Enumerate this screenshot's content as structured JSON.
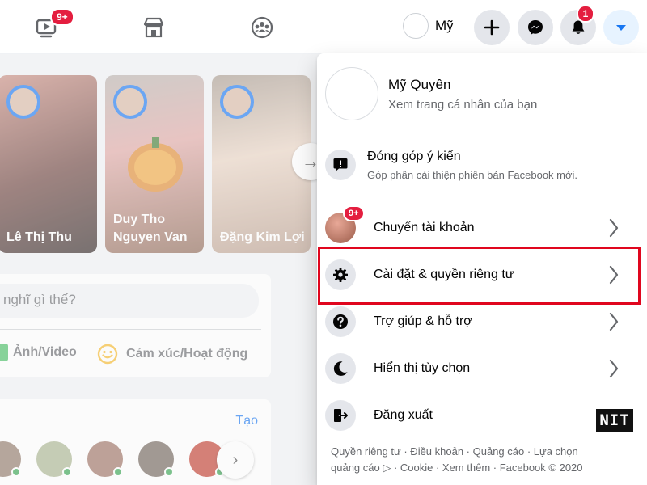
{
  "nav": {
    "watch_badge": "9+",
    "profile_name": "Mỹ",
    "notifications_badge": "1"
  },
  "feed": {
    "stories": [
      {
        "name": "Lê Thị Thu"
      },
      {
        "name": "Duy Tho Nguyen Van"
      },
      {
        "name": "Đặng Kim Lợi"
      }
    ],
    "composer_prompt": "nghĩ gì thế?",
    "photo_video": "Ảnh/Video",
    "feeling_activity": "Cảm xúc/Hoạt động",
    "rooms_create": "Tạo"
  },
  "menu": {
    "profile": {
      "name": "Mỹ Quyên",
      "subtitle": "Xem trang cá nhân của bạn"
    },
    "feedback": {
      "title": "Đóng góp ý kiến",
      "subtitle": "Góp phần cải thiện phiên bản Facebook mới."
    },
    "switch_account": {
      "label": "Chuyển tài khoản",
      "badge": "9+"
    },
    "settings_privacy": {
      "label": "Cài đặt & quyền riêng tư"
    },
    "help_support": {
      "label": "Trợ giúp & hỗ trợ"
    },
    "display_preferences": {
      "label": "Hiển thị tùy chọn"
    },
    "logout": {
      "label": "Đăng xuất"
    },
    "footer_line1": "Quyền riêng tư · Điều khoản · Quảng cáo · Lựa chọn",
    "footer_line2": "quảng cáo ▷ · Cookie · Xem thêm · Facebook © 2020"
  },
  "watermark": "NIT",
  "colors": {
    "brand": "#1877f2",
    "badge": "#e41e3f",
    "highlight": "#e0061e"
  }
}
